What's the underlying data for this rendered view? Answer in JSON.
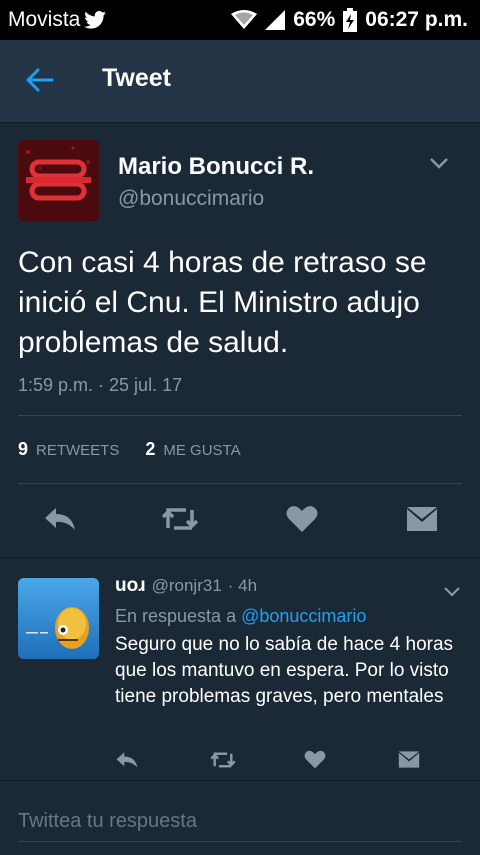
{
  "status_bar": {
    "carrier": "Movista",
    "battery": "66%",
    "time": "06:27 p.m."
  },
  "header": {
    "title": "Tweet"
  },
  "tweet": {
    "author_name": "Mario Bonucci R.",
    "author_handle": "@bonuccimario",
    "text": "Con casi 4 horas de retraso se inició el Cnu. El Ministro adujo problemas de salud.",
    "timestamp": "1:59 p.m. · 25 jul. 17",
    "retweets_count": "9",
    "retweets_label": "RETWEETS",
    "likes_count": "2",
    "likes_label": "ME GUSTA"
  },
  "reply": {
    "name": "uoɹ",
    "handle": "@ronjr31",
    "time": "· 4h",
    "context_prefix": "En respuesta a",
    "context_mention": "@bonuccimario",
    "text": "Seguro que no lo sabía de hace 4 horas que los mantuvo en espera. Por lo visto tiene problemas graves, pero mentales"
  },
  "compose": {
    "placeholder": "Twittea tu respuesta"
  },
  "colors": {
    "background": "#1b2836",
    "header": "#243447",
    "accent": "#1da1f2",
    "muted": "#8899a6"
  }
}
